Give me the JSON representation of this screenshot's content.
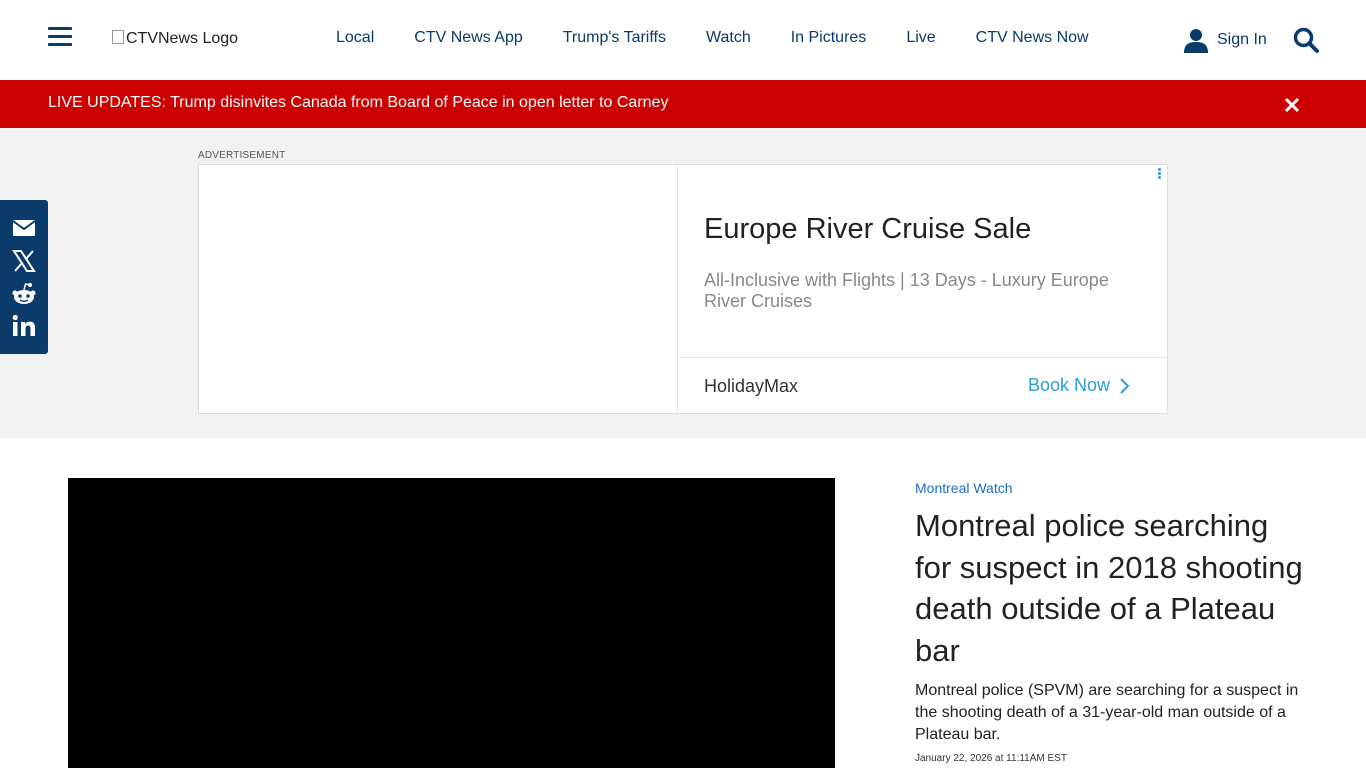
{
  "header": {
    "logo_alt": "CTVNews Logo",
    "nav": [
      {
        "label": "Local"
      },
      {
        "label": "CTV News App"
      },
      {
        "label": "Trump's Tariffs"
      },
      {
        "label": "Watch"
      },
      {
        "label": "In Pictures"
      },
      {
        "label": "Live"
      },
      {
        "label": "CTV News Now"
      }
    ],
    "sign_in": "Sign In"
  },
  "breaking": {
    "text": "LIVE UPDATES: Trump disinvites Canada from Board of Peace in open letter to Carney"
  },
  "ad": {
    "label": "ADVERTISEMENT",
    "title": "Europe River Cruise Sale",
    "description": "All-Inclusive with Flights | 13 Days - Luxury Europe River Cruises",
    "brand": "HolidayMax",
    "cta": "Book Now"
  },
  "share": {
    "icons": [
      "email-icon",
      "x-icon",
      "reddit-icon",
      "linkedin-icon"
    ]
  },
  "article": {
    "kicker": "Montreal Watch",
    "headline": "Montreal police searching for suspect in 2018 shooting death outside of a Plateau bar",
    "summary": "Montreal police (SPVM) are searching for a suspect in the shooting death of a 31-year-old man outside of a Plateau bar.",
    "date": "January 22, 2026 at 11:11AM EST"
  },
  "colors": {
    "brand_navy": "#0b3b6b",
    "breaking_red": "#cc0000",
    "ad_link": "#2a9fd8",
    "kicker_blue": "#1a6fc4"
  }
}
